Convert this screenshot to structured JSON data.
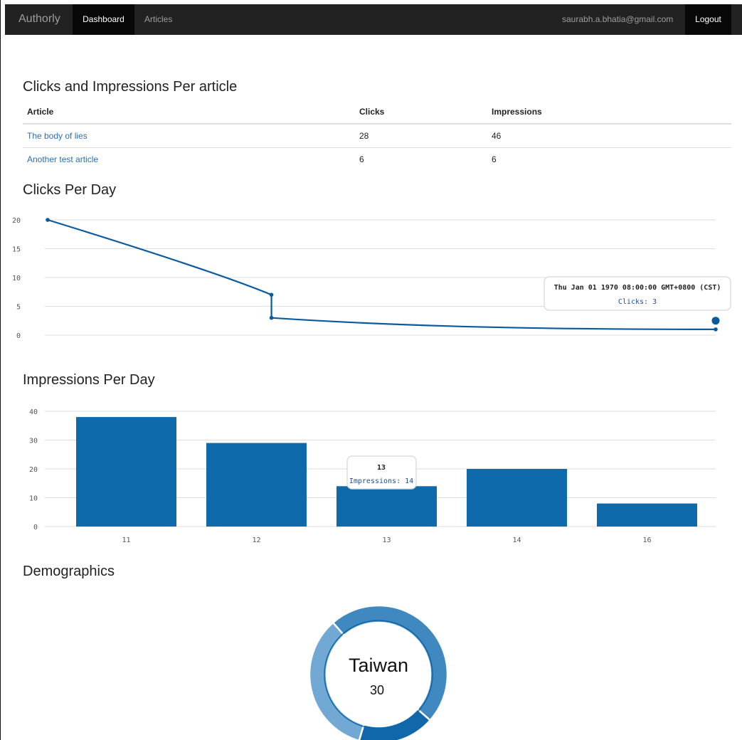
{
  "nav": {
    "brand": "Authorly",
    "dashboard": "Dashboard",
    "articles": "Articles",
    "email": "saurabh.a.bhatia@gmail.com",
    "logout": "Logout"
  },
  "table_section": {
    "title": "Clicks and Impressions Per article",
    "headers": [
      "Article",
      "Clicks",
      "Impressions"
    ],
    "rows": [
      {
        "article": "The body of lies",
        "clicks": "28",
        "impressions": "46"
      },
      {
        "article": "Another test article",
        "clicks": "6",
        "impressions": "6"
      }
    ]
  },
  "clicks_section": {
    "title": "Clicks Per Day"
  },
  "impressions_section": {
    "title": "Impressions Per Day"
  },
  "demographics_section": {
    "title": "Demographics"
  },
  "chart_data": [
    {
      "type": "line",
      "title": "Clicks Per Day",
      "yticks": [
        "0",
        "5",
        "10",
        "15",
        "20"
      ],
      "ylim": [
        0,
        20
      ],
      "points": [
        {
          "x": 0.0,
          "y": 20
        },
        {
          "x": 0.335,
          "y": 7
        },
        {
          "x": 0.335,
          "y": 3
        },
        {
          "x": 1.0,
          "y": 1
        }
      ],
      "grid": true,
      "color": "#0a5aa0",
      "tooltip": {
        "header": "Thu Jan 01 1970 08:00:00 GMT+0800 (CST)",
        "value": "Clicks: 3"
      }
    },
    {
      "type": "bar",
      "title": "Impressions Per Day",
      "categories": [
        "11",
        "12",
        "13",
        "14",
        "16"
      ],
      "values": [
        38,
        29,
        14,
        20,
        8
      ],
      "yticks": [
        "0",
        "10",
        "20",
        "30",
        "40"
      ],
      "ylim": [
        0,
        40
      ],
      "grid": true,
      "color": "#0f6aab",
      "tooltip": {
        "header": "13",
        "value": "Impressions: 14"
      }
    },
    {
      "type": "pie",
      "title": "Demographics",
      "center_label": "Taiwan",
      "center_value": "30",
      "slices": [
        {
          "color": "#4088c0",
          "fraction": 0.48
        },
        {
          "color": "#1068ab",
          "fraction": 0.18
        },
        {
          "color": "#72a8d4",
          "fraction": 0.34
        }
      ]
    }
  ]
}
